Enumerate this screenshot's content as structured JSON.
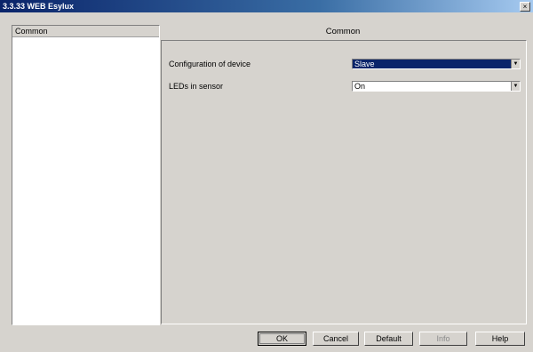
{
  "window": {
    "title": "3.3.33 WEB Esylux",
    "close_icon": "×"
  },
  "left_panel": {
    "items": [
      {
        "label": "Common"
      }
    ]
  },
  "right_panel": {
    "title": "Common",
    "params": [
      {
        "label": "Configuration of device",
        "value": "Slave"
      },
      {
        "label": "LEDs in sensor",
        "value": "On"
      }
    ]
  },
  "buttons": {
    "ok": "OK",
    "cancel": "Cancel",
    "default": "Default",
    "info": "Info",
    "help": "Help"
  },
  "dropdown_arrow_icon": "▼",
  "colors": {
    "selection": "#0a246a",
    "dialog_bg": "#d6d3ce",
    "title_gradient_start": "#0a246a"
  }
}
